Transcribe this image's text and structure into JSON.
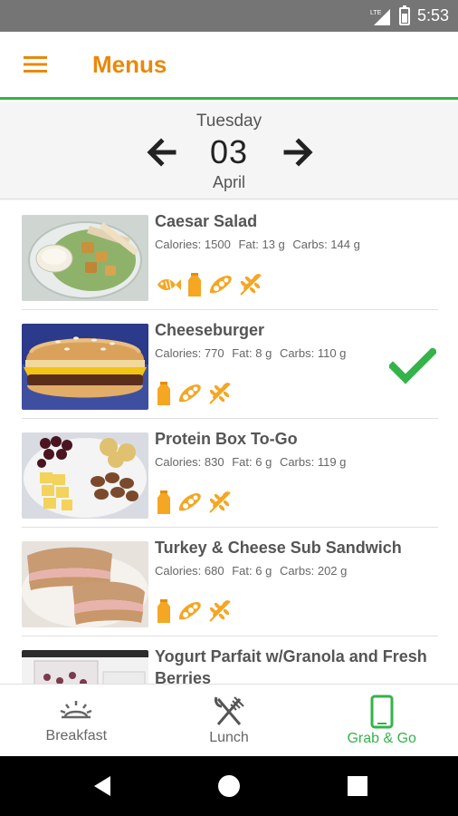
{
  "status_bar": {
    "network": "LTE",
    "time": "5:53"
  },
  "app_bar": {
    "title": "Menus"
  },
  "date": {
    "weekday": "Tuesday",
    "day": "03",
    "month": "April"
  },
  "items": [
    {
      "name": "Caesar Salad",
      "calories": "Calories: 1500",
      "fat": "Fat: 13 g",
      "carbs": "Carbs: 144 g",
      "icons": [
        "fish-icon",
        "milk-icon",
        "soy-icon",
        "wheat-icon"
      ],
      "selected": false
    },
    {
      "name": "Cheeseburger",
      "calories": "Calories: 770",
      "fat": "Fat: 8 g",
      "carbs": "Carbs: 110 g",
      "icons": [
        "milk-icon",
        "soy-icon",
        "wheat-icon"
      ],
      "selected": true
    },
    {
      "name": "Protein Box To-Go",
      "calories": "Calories: 830",
      "fat": "Fat: 6 g",
      "carbs": "Carbs: 119 g",
      "icons": [
        "milk-icon",
        "soy-icon",
        "wheat-icon"
      ],
      "selected": false
    },
    {
      "name": "Turkey & Cheese Sub Sandwich",
      "calories": "Calories: 680",
      "fat": "Fat: 6 g",
      "carbs": "Carbs: 202 g",
      "icons": [
        "milk-icon",
        "soy-icon",
        "wheat-icon"
      ],
      "selected": false
    },
    {
      "name": "Yogurt Parfait w/Granola and Fresh Berries",
      "calories": "",
      "fat": "",
      "carbs": "",
      "icons": [],
      "selected": false
    }
  ],
  "bottom_nav": {
    "breakfast": "Breakfast",
    "lunch": "Lunch",
    "grab_go": "Grab & Go",
    "active": "grab_go"
  },
  "colors": {
    "accent_orange": "#e8890c",
    "accent_green": "#34b34a",
    "icon_orange": "#f5a623"
  }
}
